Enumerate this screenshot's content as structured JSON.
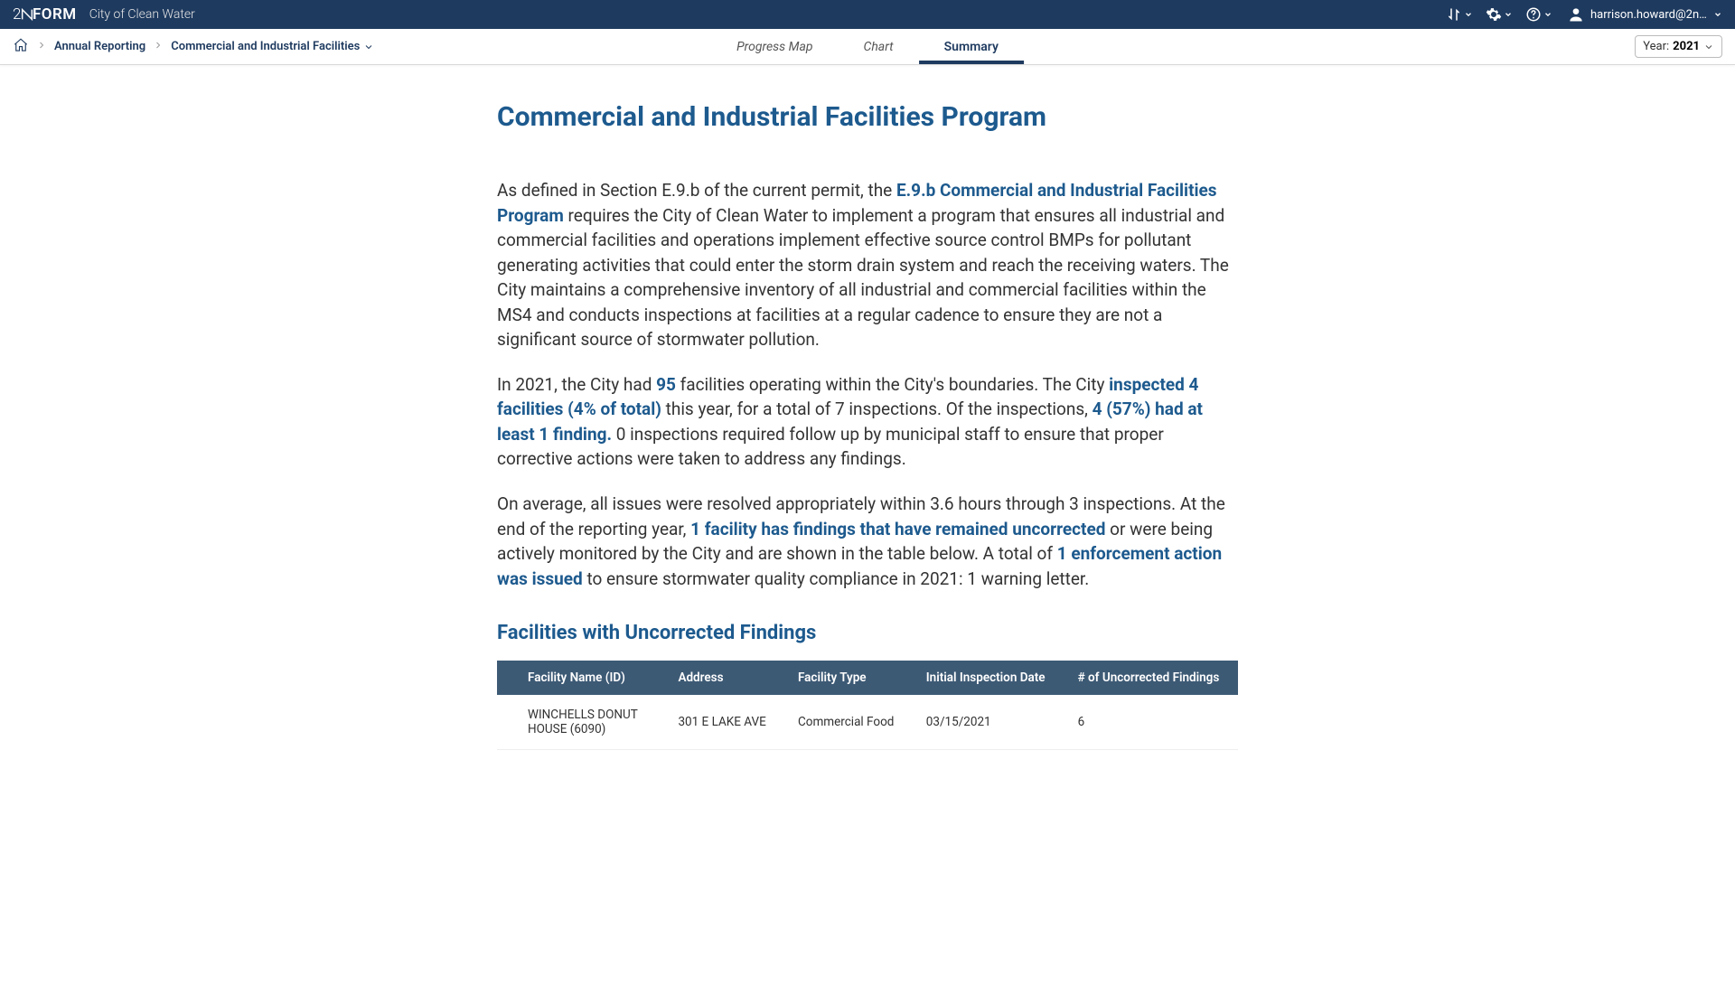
{
  "header": {
    "logo": "2NFORM",
    "city": "City of Clean Water",
    "user_email": "harrison.howard@2nd..."
  },
  "breadcrumb": {
    "item1": "Annual Reporting",
    "item2": "Commercial and Industrial Facilities"
  },
  "tabs": {
    "progress_map": "Progress Map",
    "chart": "Chart",
    "summary": "Summary"
  },
  "year_selector": {
    "label": "Year: ",
    "value": "2021"
  },
  "page": {
    "title": "Commercial and Industrial Facilities Program",
    "p1_pre": "As defined in Section E.9.b of the current permit, the ",
    "p1_hl1": "E.9.b Commercial and Industrial Facilities Program",
    "p1_post": " requires the City of Clean Water to implement a program that ensures all industrial and commercial facilities and operations implement effective source control BMPs for pollutant generating activities that could enter the storm drain system and reach the receiving waters. The City maintains a comprehensive inventory of all industrial and commercial facilities within the MS4 and conducts inspections at facilities at a regular cadence to ensure they are not a significant source of stormwater pollution.",
    "p2_a": "In 2021, the City had ",
    "p2_hl1": "95",
    "p2_b": " facilities operating within the City's boundaries. The City ",
    "p2_hl2": "inspected 4 facilities (4% of total)",
    "p2_c": " this year, for a total of 7 inspections. Of the inspections, ",
    "p2_hl3": "4 (57%) had at least 1 finding.",
    "p2_d": " 0 inspections required follow up by municipal staff to ensure that proper corrective actions were taken to address any findings.",
    "p3_a": "On average, all issues were resolved appropriately within 3.6 hours through 3 inspections. At the end of the reporting year, ",
    "p3_hl1": "1 facility has findings that have remained uncorrected",
    "p3_b": " or were being actively monitored by the City and are shown in the table below. A total of ",
    "p3_hl2": "1 enforcement action was issued",
    "p3_c": " to ensure stormwater quality compliance in 2021: 1 warning letter.",
    "section_title": "Facilities with Uncorrected Findings"
  },
  "table": {
    "headers": {
      "c1": "Facility Name (ID)",
      "c2": "Address",
      "c3": "Facility Type",
      "c4": "Initial Inspection Date",
      "c5": "# of Uncorrected Findings"
    },
    "rows": [
      {
        "name": "WINCHELLS DONUT HOUSE (6090)",
        "address": "301 E LAKE AVE",
        "type": "Commercial Food",
        "date": "03/15/2021",
        "findings": "6"
      }
    ]
  }
}
